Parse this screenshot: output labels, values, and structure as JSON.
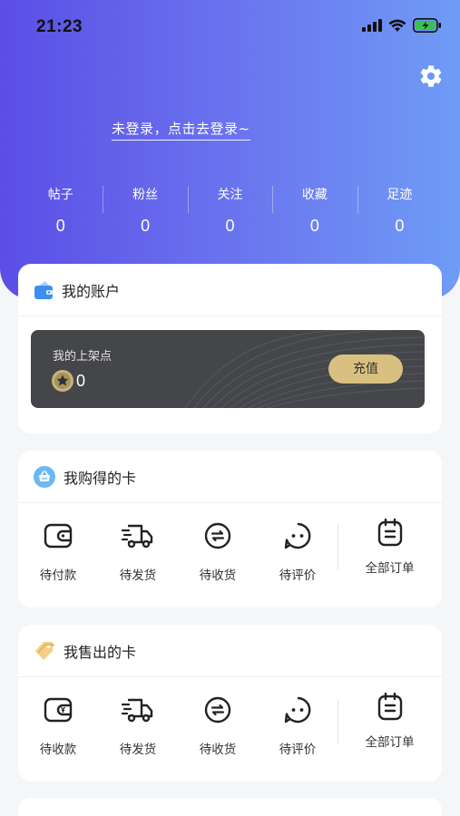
{
  "status_bar": {
    "time": "21:23"
  },
  "header": {
    "login_prompt": "未登录，点击去登录~",
    "stats": [
      {
        "label": "帖子",
        "value": "0"
      },
      {
        "label": "粉丝",
        "value": "0"
      },
      {
        "label": "关注",
        "value": "0"
      },
      {
        "label": "收藏",
        "value": "0"
      },
      {
        "label": "足迹",
        "value": "0"
      }
    ]
  },
  "account": {
    "title": "我的账户",
    "balance_label": "我的上架点",
    "balance_value": "0",
    "recharge_label": "充值"
  },
  "bought": {
    "title": "我购得的卡",
    "items": [
      "待付款",
      "待发货",
      "待收货",
      "待评价"
    ],
    "all_label": "全部订单"
  },
  "sold": {
    "title": "我售出的卡",
    "items": [
      "待收款",
      "待发货",
      "待收货",
      "待评价"
    ],
    "all_label": "全部订单"
  },
  "colors": {
    "accent_start": "#5b4ee6",
    "accent_end": "#6f9cf6",
    "gold": "#d8c081",
    "balance_bg": "#454649"
  },
  "icons": [
    "settings-gear-icon",
    "wallet-icon",
    "basket-icon",
    "tag-icon",
    "coin-star-icon",
    "truck-icon",
    "exchange-icon",
    "chat-icon",
    "clipboard-icon"
  ]
}
